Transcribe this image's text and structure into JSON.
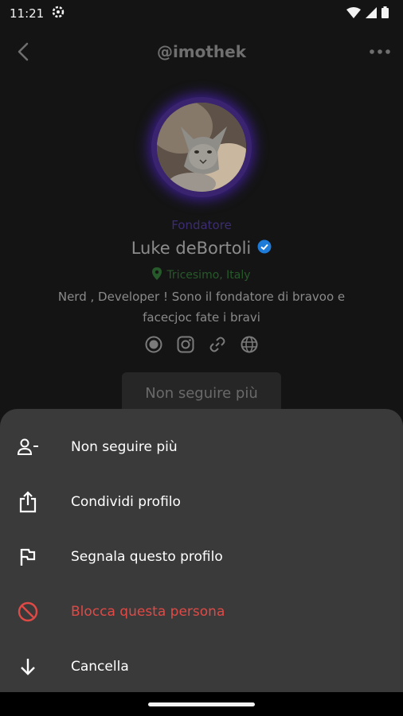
{
  "status_bar": {
    "time": "11:21"
  },
  "header": {
    "handle": "@imothek"
  },
  "profile": {
    "role": "Fondatore",
    "name": "Luke deBortoli",
    "location": "Tricesimo, Italy",
    "bio": "Nerd , Developer ! Sono il fondatore di bravoo e facecjoc fate i bravi",
    "follow_button": "Non seguire più",
    "social_icons": [
      "record-icon",
      "instagram-icon",
      "link-icon",
      "globe-icon"
    ]
  },
  "sheet": {
    "items": [
      {
        "label": "Non seguire più",
        "icon": "person-remove-icon"
      },
      {
        "label": "Condividi profilo",
        "icon": "share-icon"
      },
      {
        "label": "Segnala questo profilo",
        "icon": "flag-icon"
      },
      {
        "label": "Blocca questa persona",
        "icon": "block-icon"
      },
      {
        "label": "Cancella",
        "icon": "arrow-down-icon"
      }
    ]
  },
  "colors": {
    "role": "#3c2c72",
    "location": "#275a2a",
    "danger": "#e04a46",
    "sheet_bg": "#3a3a3a",
    "verified": "#1f7bd8"
  }
}
